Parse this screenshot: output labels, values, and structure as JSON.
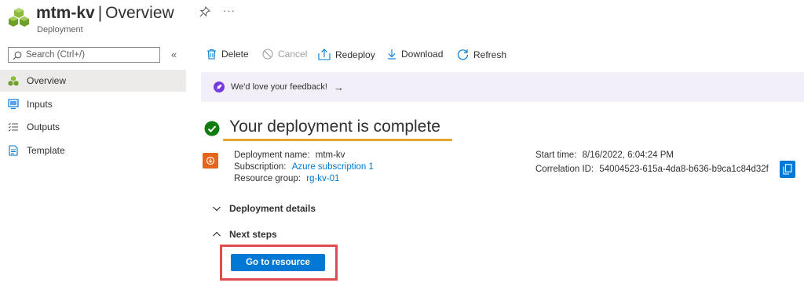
{
  "header": {
    "resource_name": "mtm-kv",
    "separator": "|",
    "page": "Overview",
    "resource_type": "Deployment",
    "more_label": "···"
  },
  "sidebar": {
    "search_placeholder": "Search (Ctrl+/)",
    "collapse_label": "«",
    "items": [
      {
        "label": "Overview",
        "icon": "overview-icon",
        "active": true
      },
      {
        "label": "Inputs",
        "icon": "inputs-icon"
      },
      {
        "label": "Outputs",
        "icon": "outputs-icon"
      },
      {
        "label": "Template",
        "icon": "template-icon"
      }
    ]
  },
  "toolbar": {
    "delete": "Delete",
    "cancel": "Cancel",
    "redeploy": "Redeploy",
    "download": "Download",
    "refresh": "Refresh"
  },
  "feedback": {
    "text": "We'd love your feedback!",
    "arrow": "→"
  },
  "status": {
    "title": "Your deployment is complete"
  },
  "details": {
    "name_label": "Deployment name:",
    "name_value": "mtm-kv",
    "subscription_label": "Subscription:",
    "subscription_value": "Azure subscription 1",
    "rg_label": "Resource group:",
    "rg_value": "rg-kv-01",
    "start_label": "Start time:",
    "start_value": "8/16/2022, 6:04:24 PM",
    "correlation_label": "Correlation ID:",
    "correlation_value": "54004523-615a-4da8-b636-b9ca1c84d32f"
  },
  "sections": {
    "deployment_details": "Deployment details",
    "next_steps": "Next steps"
  },
  "actions": {
    "go_to_resource": "Go to resource"
  },
  "colors": {
    "accent": "#0078d4",
    "success": "#107c10",
    "highlight_underline": "#e9a42c",
    "highlight_frame": "#e04b4b",
    "feedback_bg": "#f3eff8"
  }
}
